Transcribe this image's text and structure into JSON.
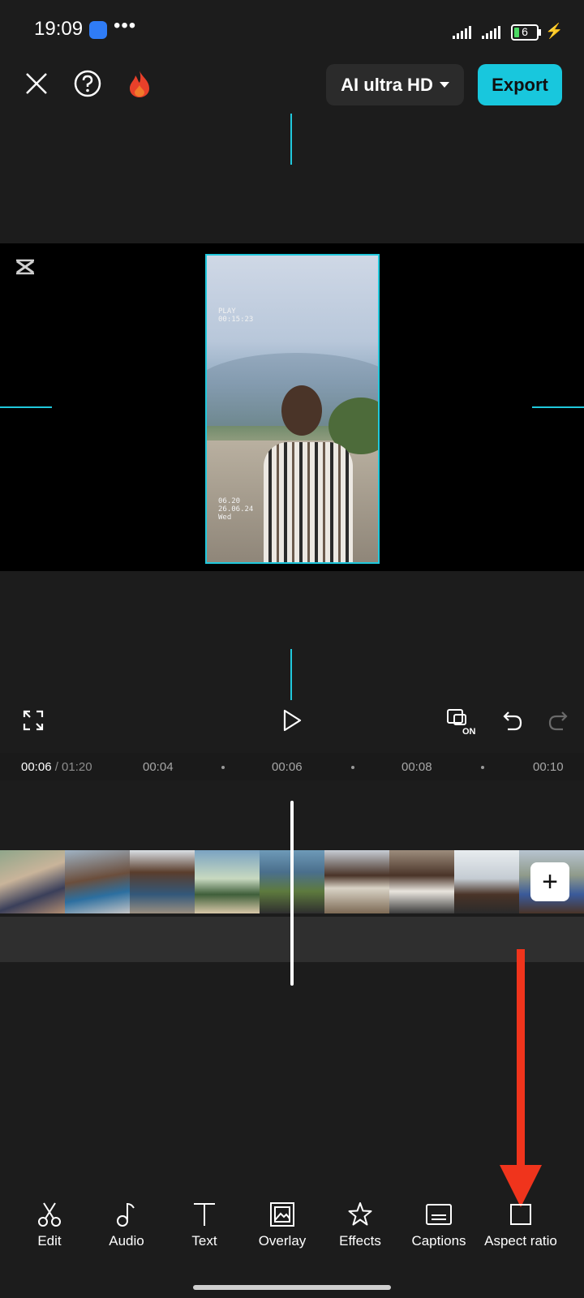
{
  "status_bar": {
    "time": "19:09",
    "dots": "•••",
    "battery": "6",
    "icons": [
      "messages-app-icon",
      "signal-icon",
      "signal-icon",
      "battery-icon",
      "charging-bolt-icon"
    ]
  },
  "top_bar": {
    "close_icon": "close-icon",
    "help_icon": "help-icon",
    "fire_icon": "fire-icon",
    "quality_label": "AI ultra HD",
    "export_label": "Export"
  },
  "preview": {
    "overlay_play": "PLAY\n00:15:23",
    "overlay_date": "06.20\n26.06.24\nWed"
  },
  "timeline": {
    "current": "00:06",
    "total": " / 01:20",
    "ticks": [
      "00:04",
      "00:06",
      "00:08",
      "00:10"
    ]
  },
  "toolbar": {
    "items": [
      {
        "label": "Edit",
        "icon": "scissors-icon"
      },
      {
        "label": "Audio",
        "icon": "music-note-icon"
      },
      {
        "label": "Text",
        "icon": "text-icon"
      },
      {
        "label": "Overlay",
        "icon": "overlay-icon"
      },
      {
        "label": "Effects",
        "icon": "effects-star-icon"
      },
      {
        "label": "Captions",
        "icon": "captions-icon"
      },
      {
        "label": "Aspect ratio",
        "icon": "aspect-ratio-icon"
      }
    ]
  },
  "colors": {
    "accent": "#18c7dd",
    "background": "#1c1c1c",
    "annotation_arrow": "#f0341c"
  }
}
